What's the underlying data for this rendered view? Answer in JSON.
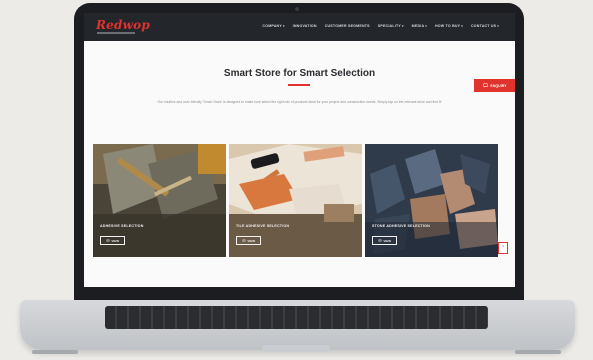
{
  "site": {
    "logo": "Redwop",
    "nav": [
      {
        "label": "COMPANY",
        "caret": true
      },
      {
        "label": "INNOVATION",
        "caret": false
      },
      {
        "label": "CUSTOMER SEGMENTS",
        "caret": false
      },
      {
        "label": "SPECIALITY",
        "caret": true
      },
      {
        "label": "MEDIA",
        "caret": true
      },
      {
        "label": "HOW TO BUY",
        "caret": true
      },
      {
        "label": "CONTACT US",
        "caret": true
      }
    ]
  },
  "hero": {
    "title": "Smart Store for Smart Selection",
    "description": "Our intuitive and user-friendly 'Smart Store' is designed to make sure select the right mix of products ideal for your project and construction needs. Simply tap on the relevant store and find it!"
  },
  "enquiry_button": "ENQUIRY",
  "cards": [
    {
      "caption": "ADHESIVE SELECTION",
      "button": "VIEW"
    },
    {
      "caption": "TILE ADHESIVE SELECTION",
      "button": "VIEW"
    },
    {
      "caption": "STONE ADHESIVE SELECTION",
      "button": "VIEW"
    }
  ],
  "colors": {
    "brand": "#e0332e",
    "header_bg": "#23262b",
    "laptop_frame": "#1b1d20"
  },
  "icons": {
    "enquiry": "chat-icon",
    "view": "eye-icon",
    "scroll_top": "chevron-up-icon"
  }
}
